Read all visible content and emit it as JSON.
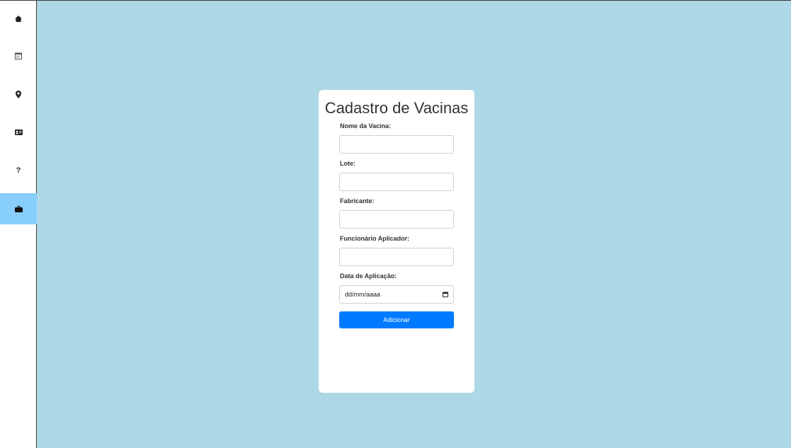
{
  "sidebar": {
    "items": [
      {
        "icon": "home-icon"
      },
      {
        "icon": "calendar-icon"
      },
      {
        "icon": "map-marker-icon"
      },
      {
        "icon": "id-card-icon"
      },
      {
        "icon": "question-icon",
        "glyph": "?"
      },
      {
        "icon": "briefcase-icon",
        "active": true
      }
    ]
  },
  "form": {
    "title": "Cadastro de Vacinas",
    "fields": [
      {
        "label": "Nome da Vacina:",
        "value": ""
      },
      {
        "label": "Lote:",
        "value": ""
      },
      {
        "label": "Fabricante:",
        "value": ""
      },
      {
        "label": "Funcionário Aplicador:",
        "value": ""
      },
      {
        "label": "Data de Aplicação:",
        "value": "dd/mm/aaaa"
      }
    ],
    "submit_label": "Adicionar"
  },
  "colors": {
    "background": "#add8e6",
    "sidebar_active": "#87cefa",
    "button": "#007bff"
  }
}
